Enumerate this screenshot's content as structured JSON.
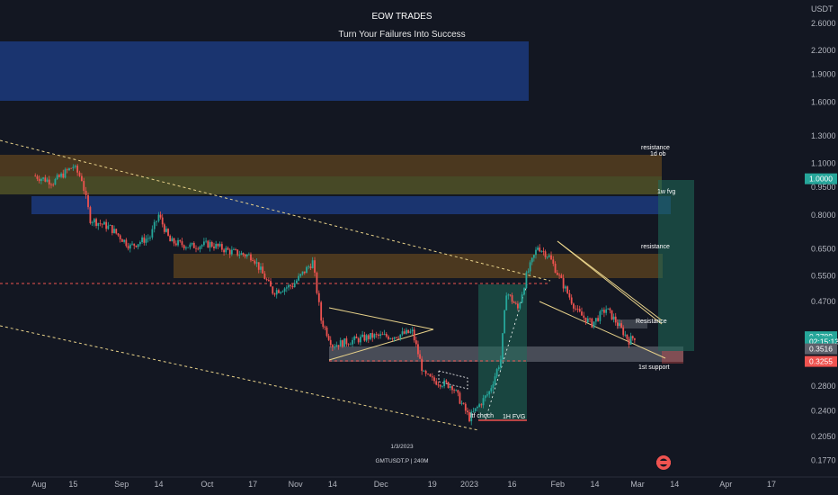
{
  "header": {
    "title": "EOW TRADES",
    "subtitle": "Turn Your Failures Into Success"
  },
  "footer": {
    "date_label": "1/3/2023",
    "symbol_label": "GMTUSDT.P | 240M"
  },
  "axis": {
    "unit": "USDT"
  },
  "colors": {
    "background": "#131722",
    "up": "#26a69a",
    "down": "#ef5350",
    "blue_zone": "#1e3f8a",
    "olive_zone": "#6b6a2a",
    "brown_zone": "#6a4a1e",
    "gray_zone": "#8a8f99",
    "green_box": "#1f6b5a",
    "trend": "#e8d28a",
    "dashed_red": "#ef5350"
  },
  "chart_data": {
    "type": "candlestick",
    "y_scale": "log",
    "ylim": [
      0.16,
      3.0
    ],
    "y_ticks": [
      "2.6000",
      "2.2000",
      "1.9000",
      "1.6000",
      "1.3000",
      "1.1000",
      "0.9500",
      "0.8000",
      "0.6500",
      "0.5500",
      "0.4700",
      "0.3789",
      "0.3516",
      "0.3255",
      "0.2800",
      "0.2400",
      "0.2050",
      "0.1770"
    ],
    "x_ticks": [
      "Aug",
      "15",
      "Sep",
      "14",
      "Oct",
      "17",
      "Nov",
      "14",
      "Dec",
      "19",
      "2023",
      "16",
      "Feb",
      "14",
      "Mar",
      "14",
      "Apr",
      "17"
    ],
    "price_path": [
      {
        "x": "Aug 1",
        "y": 1.02
      },
      {
        "x": "Aug 8",
        "y": 0.98
      },
      {
        "x": "Aug 15",
        "y": 1.08
      },
      {
        "x": "Aug 18",
        "y": 1.0
      },
      {
        "x": "Aug 21",
        "y": 0.78
      },
      {
        "x": "Aug 28",
        "y": 0.74
      },
      {
        "x": "Sep 4",
        "y": 0.66
      },
      {
        "x": "Sep 11",
        "y": 0.7
      },
      {
        "x": "Sep 14",
        "y": 0.8
      },
      {
        "x": "Sep 18",
        "y": 0.68
      },
      {
        "x": "Sep 25",
        "y": 0.66
      },
      {
        "x": "Oct 2",
        "y": 0.67
      },
      {
        "x": "Oct 9",
        "y": 0.64
      },
      {
        "x": "Oct 17",
        "y": 0.62
      },
      {
        "x": "Oct 24",
        "y": 0.5
      },
      {
        "x": "Oct 31",
        "y": 0.52
      },
      {
        "x": "Nov 7",
        "y": 0.6
      },
      {
        "x": "Nov 10",
        "y": 0.42
      },
      {
        "x": "Nov 14",
        "y": 0.36
      },
      {
        "x": "Nov 21",
        "y": 0.37
      },
      {
        "x": "Nov 28",
        "y": 0.38
      },
      {
        "x": "Dec 5",
        "y": 0.38
      },
      {
        "x": "Dec 12",
        "y": 0.39
      },
      {
        "x": "Dec 16",
        "y": 0.3
      },
      {
        "x": "Dec 19",
        "y": 0.29
      },
      {
        "x": "Dec 26",
        "y": 0.28
      },
      {
        "x": "Jan 1",
        "y": 0.23
      },
      {
        "x": "Jan 8",
        "y": 0.27
      },
      {
        "x": "Jan 12",
        "y": 0.33
      },
      {
        "x": "Jan 14",
        "y": 0.5
      },
      {
        "x": "Jan 18",
        "y": 0.45
      },
      {
        "x": "Jan 21",
        "y": 0.55
      },
      {
        "x": "Jan 25",
        "y": 0.66
      },
      {
        "x": "Jan 29",
        "y": 0.62
      },
      {
        "x": "Feb 3",
        "y": 0.52
      },
      {
        "x": "Feb 8",
        "y": 0.44
      },
      {
        "x": "Feb 13",
        "y": 0.41
      },
      {
        "x": "Feb 18",
        "y": 0.45
      },
      {
        "x": "Feb 22",
        "y": 0.41
      },
      {
        "x": "Feb 26",
        "y": 0.37
      },
      {
        "x": "Feb 28",
        "y": 0.3789
      }
    ],
    "price_badges": [
      {
        "label": "1.0000",
        "price": 1.0,
        "color": "#26a69a"
      },
      {
        "label": "0.3789",
        "price": 0.3789,
        "color": "#26a69a"
      },
      {
        "label": "02:15:13",
        "price": 0.368,
        "color": "#26a69a"
      },
      {
        "label": "0.3516",
        "price": 0.3516,
        "color": "#5d606b"
      },
      {
        "label": "0.3255",
        "price": 0.3255,
        "color": "#ef5350"
      }
    ],
    "annotations": [
      {
        "text": "resistance",
        "kind": "label"
      },
      {
        "text": "1d ob",
        "kind": "label"
      },
      {
        "text": "1w fvg",
        "kind": "label"
      },
      {
        "text": "resistance",
        "kind": "label"
      },
      {
        "text": "Resistance",
        "kind": "label"
      },
      {
        "text": "1st support",
        "kind": "label"
      },
      {
        "text": "ltf choch",
        "kind": "label"
      },
      {
        "text": "1H FVG",
        "kind": "label"
      }
    ],
    "zones": [
      {
        "name": "blue-zone-top",
        "top": 2.35,
        "bottom": 1.72
      },
      {
        "name": "brown-zone-high",
        "top": 1.16,
        "bottom": 1.05
      },
      {
        "name": "olive-zone-high",
        "top": 1.05,
        "bottom": 0.93
      },
      {
        "name": "blue-zone-mid",
        "top": 0.93,
        "bottom": 0.82
      },
      {
        "name": "brown-zone-mid",
        "top": 0.62,
        "bottom": 0.53
      },
      {
        "name": "gray-support-zone",
        "top": 0.355,
        "bottom": 0.335
      }
    ]
  }
}
